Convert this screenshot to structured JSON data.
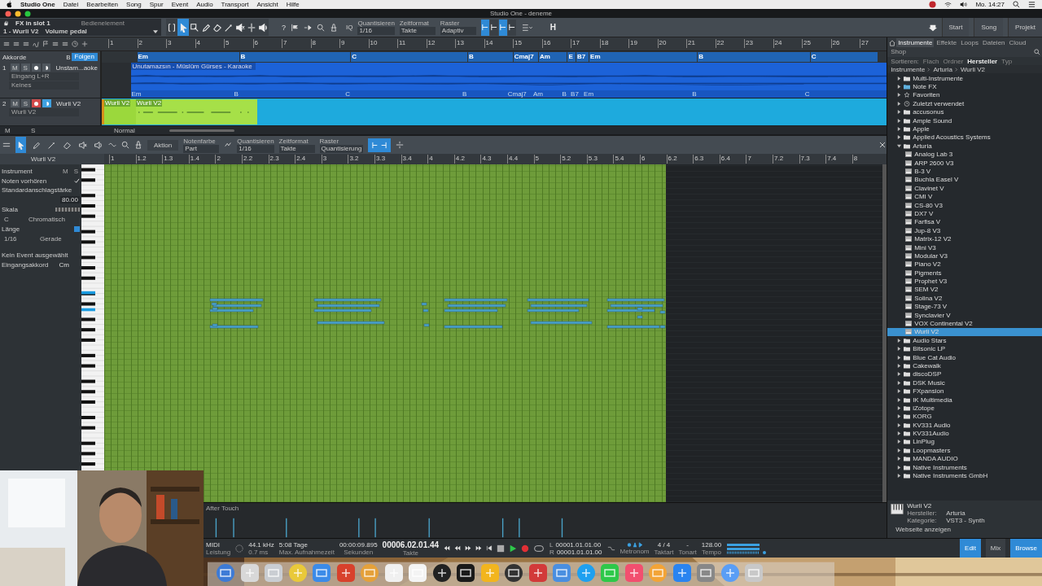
{
  "menubar": {
    "app": "Studio One",
    "items": [
      "Datei",
      "Bearbeiten",
      "Song",
      "Spur",
      "Event",
      "Audio",
      "Transport",
      "Ansicht",
      "Hilfe"
    ],
    "clock": "Mo. 14:27"
  },
  "window": {
    "title": "Studio One - deneme"
  },
  "toolbar": {
    "control_title": "FX in slot 1",
    "control_track": "1 - Wurli V2",
    "control_param": "Volume pedal",
    "control_label": "Bedienelement",
    "tools": [
      {
        "kind": "range",
        "selected": false
      },
      {
        "kind": "arrow",
        "selected": true
      },
      {
        "kind": "box",
        "selected": false
      },
      {
        "kind": "pencil",
        "selected": false
      },
      {
        "kind": "eraser",
        "selected": false
      },
      {
        "kind": "paint",
        "selected": false
      },
      {
        "kind": "mute",
        "selected": false
      },
      {
        "kind": "split",
        "selected": false
      },
      {
        "kind": "listen",
        "selected": false
      }
    ],
    "help": "?",
    "iq": "IQ",
    "settings": [
      {
        "label": "Quantisieren",
        "value": "1/16"
      },
      {
        "label": "Zeitformat",
        "value": "Takte"
      },
      {
        "label": "Raster",
        "value": "Adaptiv"
      }
    ],
    "snap_buttons": [
      {
        "on": true
      },
      {
        "on": false
      },
      {
        "on": true
      },
      {
        "on": false
      }
    ],
    "h_button": "H",
    "nav": [
      "Start",
      "Song",
      "Projekt"
    ]
  },
  "arrange": {
    "ruler": [
      "1",
      "2",
      "3",
      "4",
      "5",
      "6",
      "7",
      "8",
      "9",
      "10",
      "11",
      "12",
      "13",
      "14",
      "15",
      "16",
      "17",
      "18",
      "19",
      "20",
      "21",
      "22",
      "23",
      "24",
      "25",
      "26",
      "27"
    ],
    "chord_track": {
      "name": "Akkorde",
      "key": "B",
      "follow": "Folgen",
      "chords": [
        "Em",
        "B",
        "C",
        "B",
        "Cmaj7",
        "Am",
        "E",
        "B7",
        "Em",
        "B",
        "C"
      ]
    },
    "tracks": [
      {
        "number": "1",
        "name": "Unstam...aoke",
        "mute": "M",
        "solo": "S",
        "record": false,
        "monitor": false,
        "input": "Eingang L+R",
        "output": "Keines",
        "event": "Unutamazsın - Müslüm Gürses - Karaoke",
        "event_chords": [
          "Em",
          "B",
          "C",
          "B",
          "Cmaj7",
          "Am",
          "B",
          "B7",
          "Em",
          "B",
          "C"
        ]
      },
      {
        "number": "2",
        "name": "Wurli V2",
        "mute": "M",
        "solo": "S",
        "record": true,
        "monitor": true,
        "output": "Wurli V2",
        "events": [
          "Wurli V2",
          "Wurli V2"
        ]
      }
    ],
    "footer": {
      "m": "M",
      "s": "S",
      "mode": "Normal"
    }
  },
  "editor": {
    "toolbar": {
      "action": "Aktion",
      "settings": [
        {
          "label": "Notenfarbe",
          "value": "Part"
        },
        {
          "label": "Quantisieren",
          "value": "1/16"
        },
        {
          "label": "Zeitformat",
          "value": "Takte"
        },
        {
          "label": "Raster",
          "value": "Quantisierung"
        }
      ]
    },
    "track": "Wurli V2",
    "ruler": [
      "1",
      "1.2",
      "1.3",
      "1.4",
      "2",
      "2.2",
      "2.3",
      "2.4",
      "3",
      "3.2",
      "3.3",
      "3.4",
      "4",
      "4.2",
      "4.3",
      "4.4",
      "5",
      "5.2",
      "5.3",
      "5.4",
      "6",
      "6.2",
      "6.3",
      "6.4",
      "7",
      "7.2",
      "7.3",
      "7.4",
      "8"
    ],
    "inspector": {
      "title": "Instrument",
      "m": "M",
      "s": "S",
      "preview": {
        "label": "Noten vorhören",
        "checked": true
      },
      "velocity": {
        "label": "Standardanschlagstärke",
        "value": "80.00"
      },
      "scale": "Skala",
      "root": "C",
      "mode": "Chromatisch",
      "length": "Länge",
      "length_value": "1/16",
      "timing": "Gerade",
      "no_event": "Kein Event ausgewählt",
      "input_chord": {
        "label": "Eingangsakkord",
        "value": "Cm"
      }
    },
    "lane": "After Touch"
  },
  "browser": {
    "tabs": [
      {
        "label": "Instrumente",
        "selected": true
      },
      {
        "label": "Effekte",
        "selected": false
      },
      {
        "label": "Loops",
        "selected": false
      },
      {
        "label": "Dateien",
        "selected": false
      },
      {
        "label": "Cloud",
        "selected": false
      },
      {
        "label": "Shop",
        "selected": false
      }
    ],
    "sort_label": "Sortieren:",
    "sort": [
      {
        "label": "Flach",
        "selected": false
      },
      {
        "label": "Ordner",
        "selected": false
      },
      {
        "label": "Hersteller",
        "selected": true
      },
      {
        "label": "Typ",
        "selected": false
      }
    ],
    "path": [
      "Instrumente",
      "Arturia",
      "Wurli V2"
    ],
    "tree": [
      {
        "label": "Multi-Instrumente",
        "kind": "folder",
        "expanded": false,
        "selected": false
      },
      {
        "label": "Note FX",
        "kind": "notefx",
        "expanded": false,
        "selected": false
      },
      {
        "label": "Favoriten",
        "kind": "star",
        "expanded": false,
        "selected": false
      },
      {
        "label": "Zuletzt verwendet",
        "kind": "clock",
        "expanded": false,
        "selected": false
      },
      {
        "label": "accusonus",
        "kind": "folder",
        "expanded": false,
        "selected": false
      },
      {
        "label": "Ample Sound",
        "kind": "folder",
        "expanded": false,
        "selected": false
      },
      {
        "label": "Apple",
        "kind": "folder",
        "expanded": false,
        "selected": false
      },
      {
        "label": "Applied Acoustics Systems",
        "kind": "folder",
        "expanded": false,
        "selected": false
      },
      {
        "label": "Arturia",
        "kind": "folder",
        "expanded": true,
        "selected": false,
        "children": [
          {
            "label": "Analog Lab 3",
            "kind": "plugin",
            "selected": false
          },
          {
            "label": "ARP 2600 V3",
            "kind": "plugin",
            "selected": false
          },
          {
            "label": "B-3 V",
            "kind": "plugin",
            "selected": false
          },
          {
            "label": "Buchla Easel V",
            "kind": "plugin",
            "selected": false
          },
          {
            "label": "Clavinet V",
            "kind": "plugin",
            "selected": false
          },
          {
            "label": "CMI V",
            "kind": "plugin",
            "selected": false
          },
          {
            "label": "CS-80 V3",
            "kind": "plugin",
            "selected": false
          },
          {
            "label": "DX7 V",
            "kind": "plugin",
            "selected": false
          },
          {
            "label": "Farfisa V",
            "kind": "plugin",
            "selected": false
          },
          {
            "label": "Jup-8 V3",
            "kind": "plugin",
            "selected": false
          },
          {
            "label": "Matrix-12 V2",
            "kind": "plugin",
            "selected": false
          },
          {
            "label": "Mini V3",
            "kind": "plugin",
            "selected": false
          },
          {
            "label": "Modular V3",
            "kind": "plugin",
            "selected": false
          },
          {
            "label": "Piano V2",
            "kind": "plugin",
            "selected": false
          },
          {
            "label": "Pigments",
            "kind": "plugin",
            "selected": false
          },
          {
            "label": "Prophet V3",
            "kind": "plugin",
            "selected": false
          },
          {
            "label": "SEM V2",
            "kind": "plugin",
            "selected": false
          },
          {
            "label": "Solina V2",
            "kind": "plugin",
            "selected": false
          },
          {
            "label": "Stage-73 V",
            "kind": "plugin",
            "selected": false
          },
          {
            "label": "Synclavier V",
            "kind": "plugin",
            "selected": false
          },
          {
            "label": "VOX Continental V2",
            "kind": "plugin",
            "selected": false
          },
          {
            "label": "Wurli V2",
            "kind": "plugin",
            "selected": true
          }
        ]
      },
      {
        "label": "Audio Stars",
        "kind": "folder",
        "expanded": false,
        "selected": false
      },
      {
        "label": "Bitsonic LP",
        "kind": "folder",
        "expanded": false,
        "selected": false
      },
      {
        "label": "Blue Cat Audio",
        "kind": "folder",
        "expanded": false,
        "selected": false
      },
      {
        "label": "Cakewalk",
        "kind": "folder",
        "expanded": false,
        "selected": false
      },
      {
        "label": "discoDSP",
        "kind": "folder",
        "expanded": false,
        "selected": false
      },
      {
        "label": "DSK Music",
        "kind": "folder",
        "expanded": false,
        "selected": false
      },
      {
        "label": "FXpansion",
        "kind": "folder",
        "expanded": false,
        "selected": false
      },
      {
        "label": "IK Multimedia",
        "kind": "folder",
        "expanded": false,
        "selected": false
      },
      {
        "label": "iZotope",
        "kind": "folder",
        "expanded": false,
        "selected": false
      },
      {
        "label": "KORG",
        "kind": "folder",
        "expanded": false,
        "selected": false
      },
      {
        "label": "KV331 Audio",
        "kind": "folder",
        "expanded": false,
        "selected": false
      },
      {
        "label": "KV331Audio",
        "kind": "folder",
        "expanded": false,
        "selected": false
      },
      {
        "label": "LinPlug",
        "kind": "folder",
        "expanded": false,
        "selected": false
      },
      {
        "label": "Loopmasters",
        "kind": "folder",
        "expanded": false,
        "selected": false
      },
      {
        "label": "MANDA AUDIO",
        "kind": "folder",
        "expanded": false,
        "selected": false
      },
      {
        "label": "Native Instruments",
        "kind": "folder",
        "expanded": false,
        "selected": false
      },
      {
        "label": "Native Instruments GmbH",
        "kind": "folder",
        "expanded": false,
        "selected": false
      }
    ],
    "info": {
      "name": "Wurli V2",
      "maker_label": "Hersteller:",
      "maker": "Arturia",
      "category_label": "Kategorie:",
      "category": "VST3 - Synth",
      "link": "Webseite anzeigen"
    }
  },
  "transport": {
    "midi": "MIDI",
    "load": "Leistung",
    "rate": "44.1 kHz",
    "latency": "0.7 ms",
    "rec_time": "5:08 Tage",
    "rec_label": "Max. Aufnahmezeit",
    "seconds": "00:00:09.895",
    "seconds_label": "Sekunden",
    "bars": "00006.02.01.44",
    "bars_label": "Takte",
    "l": "L",
    "l_value": "00001.01.01.00",
    "r": "R",
    "r_value": "00001.01.01.00",
    "metronome": "Metronom",
    "signature": "4 / 4",
    "signature_label": "Taktart",
    "key": "-",
    "key_label": "Tonart",
    "tempo": "128.00",
    "tempo_label": "Tempo",
    "views": [
      {
        "label": "Edit",
        "selected": true
      },
      {
        "label": "Mix",
        "selected": false
      },
      {
        "label": "Browse",
        "selected": true
      }
    ]
  }
}
